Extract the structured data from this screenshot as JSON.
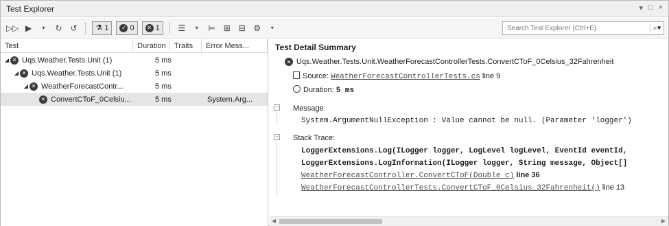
{
  "window": {
    "title": "Test Explorer",
    "controls": [
      "▾",
      "□",
      "×"
    ]
  },
  "toolbar": {
    "counts": {
      "total": "1",
      "passed": "0",
      "failed": "1"
    },
    "search_placeholder": "Search Test Explorer (Ctrl+E)"
  },
  "columns": {
    "test": "Test",
    "duration": "Duration",
    "traits": "Traits",
    "error": "Error Mess..."
  },
  "rows": [
    {
      "name": "Uqs.Weather.Tests.Unit (1)",
      "duration": "5 ms",
      "error": ""
    },
    {
      "name": "Uqs.Weather.Tests.Unit (1)",
      "duration": "5 ms",
      "error": ""
    },
    {
      "name": "WeatherForecastContr...",
      "duration": "5 ms",
      "error": ""
    },
    {
      "name": "ConvertCToF_0Celsiu...",
      "duration": "5 ms",
      "error": "System.Arg..."
    }
  ],
  "detail": {
    "title": "Test Detail Summary",
    "test_name": "Uqs.Weather.Tests.Unit.WeatherForecastControllerTests.ConvertCToF_0Celsius_32Fahrenheit",
    "source_label": "Source:",
    "source_file": "WeatherForecastControllerTests.cs",
    "source_line": "line 9",
    "duration_label": "Duration:",
    "duration_value": "5 ms",
    "message_label": "Message:",
    "message_text": "System.ArgumentNullException : Value cannot be null. (Parameter 'logger')",
    "stack_label": "Stack Trace:",
    "stack": [
      {
        "text": "LoggerExtensions.Log(ILogger logger, LogLevel logLevel, EventId eventId,",
        "line": ""
      },
      {
        "text": "LoggerExtensions.LogInformation(ILogger logger, String message, Object[]",
        "line": ""
      },
      {
        "text": "WeatherForecastController.ConvertCToF(Double c)",
        "line": "line 36"
      },
      {
        "text": "WeatherForecastControllerTests.ConvertCToF_0Celsius_32Fahrenheit()",
        "line": "line 13"
      }
    ]
  }
}
